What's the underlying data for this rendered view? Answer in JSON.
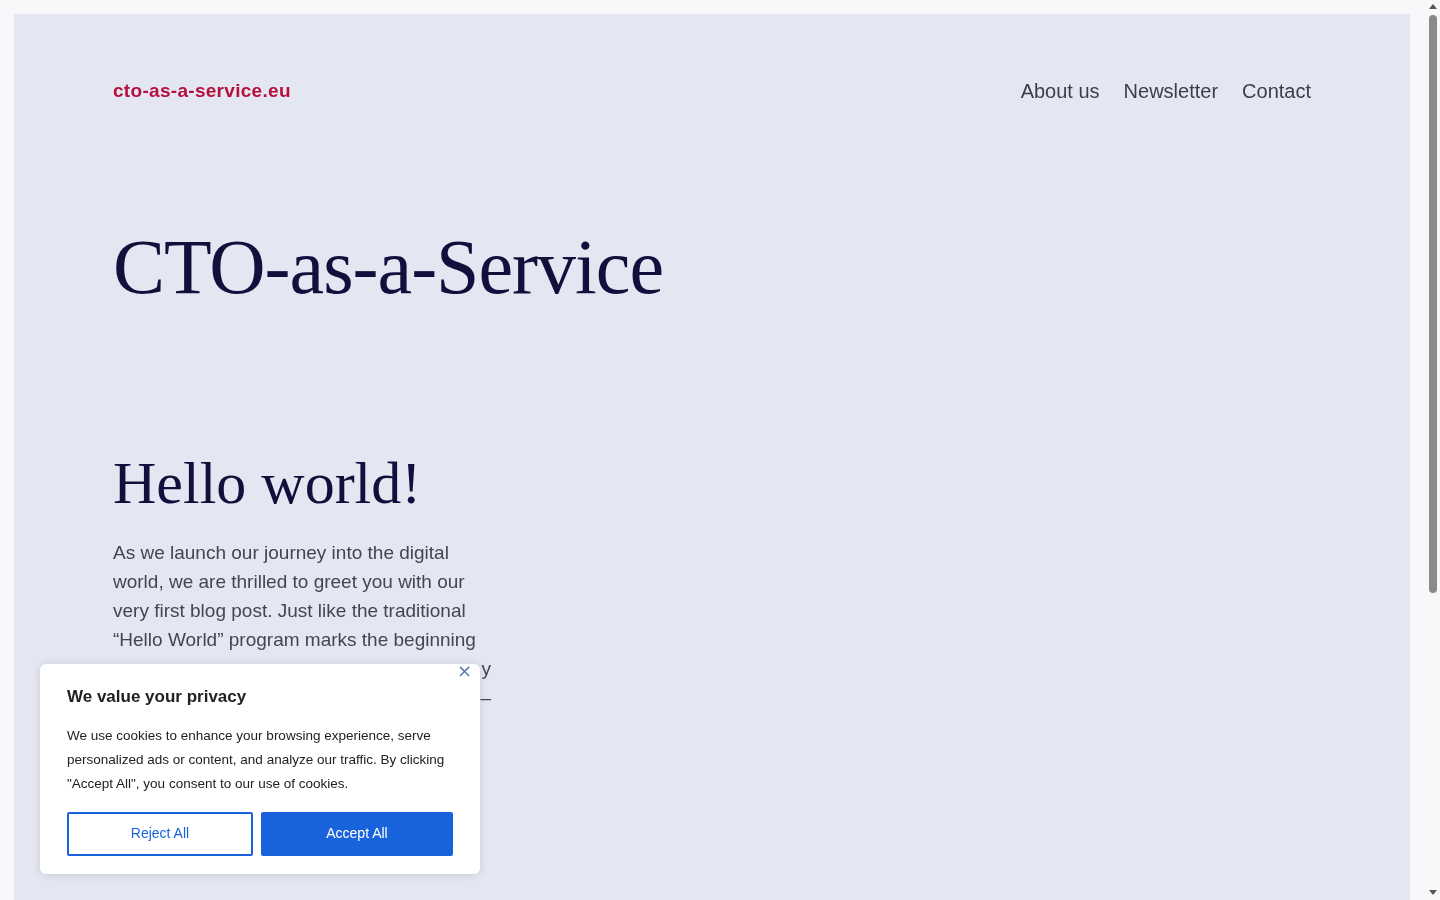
{
  "header": {
    "logo": "cto-as-a-service.eu",
    "nav": [
      {
        "label": "About us"
      },
      {
        "label": "Newsletter"
      },
      {
        "label": "Contact"
      }
    ]
  },
  "site_title": "CTO-as-a-Service",
  "post": {
    "title": "Hello world!",
    "lines": [
      {
        "text": "As we launch our journey into the digital",
        "kind": "full"
      },
      {
        "text": "world, we are thrilled to greet you with our",
        "kind": "full"
      },
      {
        "text": "very first blog post. Just like the traditional",
        "kind": "full"
      },
      {
        "text": "“Hello World” program marks the beginning",
        "kind": "full"
      },
      {
        "text": "y",
        "kind": "fragment"
      },
      {
        "text": "–",
        "kind": "fragment"
      }
    ]
  },
  "cookie_banner": {
    "close": "×",
    "title": "We value your privacy",
    "body": "We use cookies to enhance your browsing experience, serve personalized ads or content, and analyze our traffic. By clicking \"Accept All\", you consent to our use of cookies.",
    "buttons": [
      {
        "label": "Reject All",
        "kind": "outline"
      },
      {
        "label": "Accept All",
        "kind": "primary"
      }
    ]
  }
}
